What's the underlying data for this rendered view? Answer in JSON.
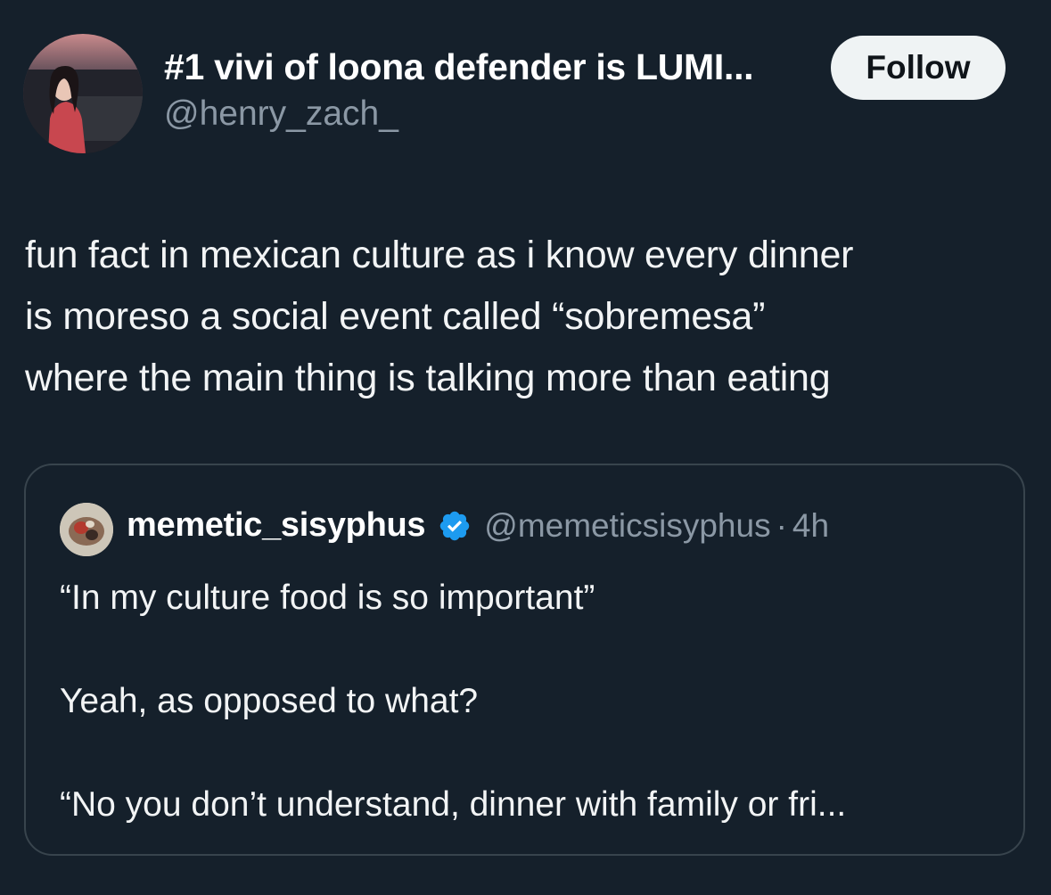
{
  "author": {
    "display_name": "#1 vivi of loona defender is LUMI...",
    "handle": "@henry_zach_"
  },
  "follow_label": "Follow",
  "tweet_lines": [
    "fun fact in mexican culture as i know every dinner",
    "is moreso a social event called “sobremesa”",
    "where the main thing is talking more than eating"
  ],
  "quote": {
    "name": "memetic_sisyphus",
    "handle": "@memeticsisyphus",
    "separator": "·",
    "time": "4h",
    "lines": [
      "“In my culture food is so important”",
      "",
      "Yeah, as opposed to what?",
      "",
      "“No you don’t understand, dinner with family or fri..."
    ]
  },
  "colors": {
    "background": "#15202b",
    "follow_bg": "#eff3f4",
    "verified": "#1d9bf0",
    "secondary_text": "#8b98a5",
    "border": "#38444d"
  },
  "icons": {
    "verified": "verified-badge-icon"
  }
}
